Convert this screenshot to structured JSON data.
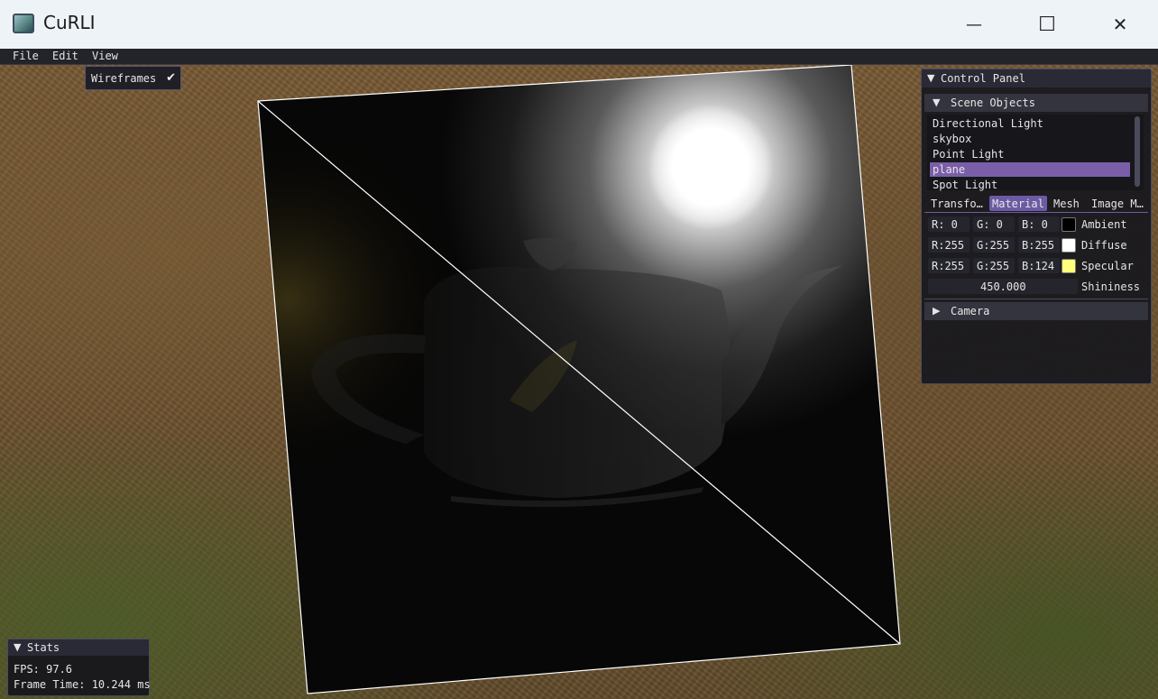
{
  "window": {
    "title": "CuRLI",
    "minimize_glyph": "—",
    "maximize_glyph": "☐",
    "close_glyph": "✕"
  },
  "menu": [
    "File",
    "Edit",
    "View"
  ],
  "view_menu": {
    "wireframes": {
      "label": "Wireframes",
      "checked": true,
      "check_glyph": "✔"
    }
  },
  "control_panel": {
    "title": "Control Panel",
    "expanded_glyph": "▼",
    "collapsed_glyph": "▶",
    "scene_objects": {
      "title": "Scene Objects",
      "items": [
        "Directional Light",
        "skybox",
        "Point Light",
        "plane",
        "Spot Light"
      ],
      "selected": "plane"
    },
    "tabs": [
      "Transfo…",
      "Material",
      "Mesh",
      "Image M…"
    ],
    "active_tab": "Material",
    "material": {
      "rows": [
        {
          "r": "R:  0",
          "g": "G:  0",
          "b": "B:  0",
          "color": "#000000",
          "name": "Ambient"
        },
        {
          "r": "R:255",
          "g": "G:255",
          "b": "B:255",
          "color": "#ffffff",
          "name": "Diffuse"
        },
        {
          "r": "R:255",
          "g": "G:255",
          "b": "B:124",
          "color": "#ffff7c",
          "name": "Specular"
        }
      ],
      "shininess_value": "450.000",
      "shininess_label": "Shininess"
    },
    "camera": {
      "title": "Camera"
    }
  },
  "stats": {
    "title": "Stats",
    "fps": "FPS: 97.6",
    "frame_time": "Frame Time: 10.244 ms"
  }
}
